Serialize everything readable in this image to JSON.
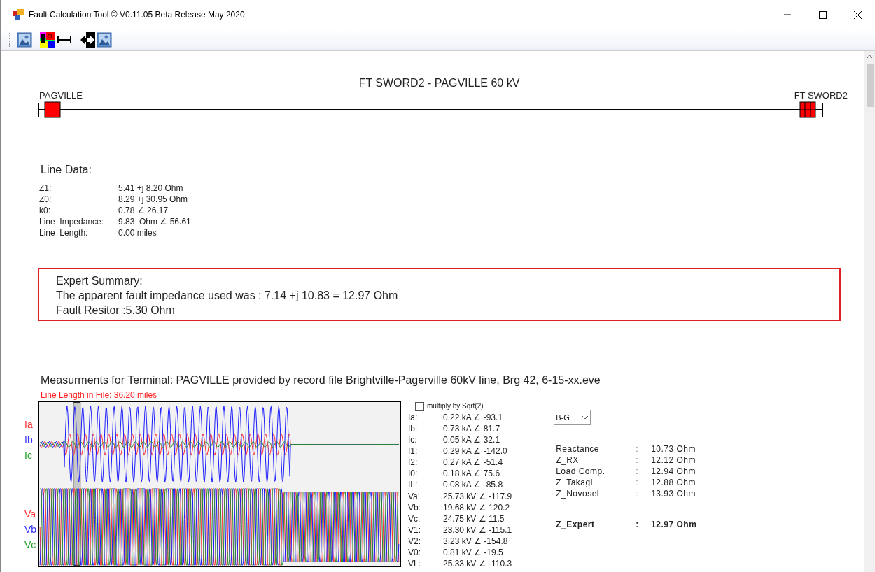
{
  "window": {
    "title": "Fault Calculation Tool © V0.11.05 Beta Release May 2020"
  },
  "toolbar": [
    {
      "kind": "picture"
    },
    {
      "kind": "colors"
    },
    {
      "kind": "span"
    },
    {
      "kind": "arrow"
    },
    {
      "kind": "picture"
    }
  ],
  "line_diagram": {
    "title": "FT SWORD2 - PAGVILLE 60 kV",
    "left_terminal": "PAGVILLE",
    "right_terminal": "FT SWORD2"
  },
  "line_data": {
    "title": "Line Data:",
    "rows": [
      {
        "label": "Z1:",
        "value": "5.41 +j 8.20 Ohm"
      },
      {
        "label": "Z0:",
        "value": "8.29 +j 30.95 Ohm"
      },
      {
        "label": "k0:",
        "value": "0.78 ∠ 26.17"
      },
      {
        "label": "Line  Impedance:",
        "value": "9.83  Ohm ∠ 56.61"
      },
      {
        "label": "Line  Length:",
        "value": "0.00 miles"
      }
    ]
  },
  "expert_summary": {
    "title": "Expert Summary:",
    "lines": [
      "The apparent fault impedance used was : 7.14 +j 10.83 = 12.97 Ohm",
      "Fault Resitor :5.30 Ohm"
    ]
  },
  "measurements": {
    "title": "Measurments for Terminal: PAGVILLE provided by record file Brightville-Pagerville 60kV line, Brg 42, 6-15-xx.eve",
    "subtitle": "Line Length in File: 36.20 miles",
    "current_labels": [
      {
        "text": "Ia",
        "color": "#ff3030"
      },
      {
        "text": "Ib",
        "color": "#3030ff"
      },
      {
        "text": "Ic",
        "color": "#20a020"
      }
    ],
    "voltage_labels": [
      {
        "text": "Va",
        "color": "#ff3030"
      },
      {
        "text": "Vb",
        "color": "#3030ff"
      },
      {
        "text": "Vc",
        "color": "#20a020"
      }
    ],
    "sqrt_checkbox": {
      "label": "multiply by Sqrt(2)",
      "checked": false
    },
    "currents": [
      {
        "label": "Ia:",
        "value": "0.22 kA ∠ -93.1"
      },
      {
        "label": "Ib:",
        "value": "0.73 kA ∠ 81.7"
      },
      {
        "label": "Ic:",
        "value": "0.05 kA ∠ 32.1"
      },
      {
        "label": "I1:",
        "value": "0.29 kA ∠ -142.0"
      },
      {
        "label": "I2:",
        "value": "0.27 kA ∠ -51.4"
      },
      {
        "label": "I0:",
        "value": "0.18 kA ∠ 75.6"
      },
      {
        "label": "IL:",
        "value": "0.08 kA ∠ -85.8"
      }
    ],
    "voltages": [
      {
        "label": "Va:",
        "value": "25.73 kV ∠ -117.9"
      },
      {
        "label": "Vb:",
        "value": "19.68 kV ∠ 120.2"
      },
      {
        "label": "Vc:",
        "value": "24.75 kV ∠ 11.5"
      },
      {
        "label": "V1:",
        "value": "23.30 kV ∠ -115.1"
      },
      {
        "label": "V2:",
        "value": "3.23 kV ∠ -154.8"
      },
      {
        "label": "V0:",
        "value": "0.81 kV ∠ -19.5"
      },
      {
        "label": "VL:",
        "value": "25.33 kV ∠ -110.3"
      }
    ],
    "fault_type": {
      "value": "B-G"
    },
    "results": [
      {
        "label": "Reactance",
        "separator": ":",
        "value": "10.73 Ohm"
      },
      {
        "label": "Z_RX",
        "separator": ":",
        "value": "12.12 Ohm"
      },
      {
        "label": "Load Comp.",
        "separator": ":",
        "value": "12.94 Ohm"
      },
      {
        "label": "Z_Takagi",
        "separator": ":",
        "value": "12.88 Ohm"
      },
      {
        "label": "Z_Novosel",
        "separator": ":",
        "value": "13.93 Ohm"
      }
    ],
    "expert_result": {
      "label": "Z_Expert",
      "separator": ":",
      "value": "12.97 Ohm"
    }
  }
}
